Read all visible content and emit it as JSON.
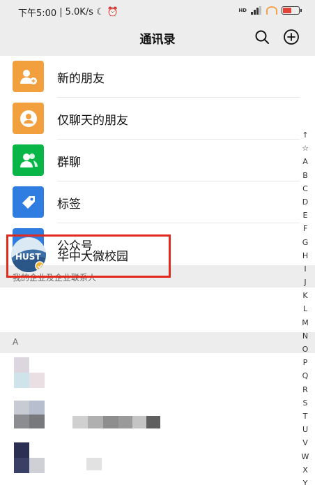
{
  "status_bar": {
    "time": "下午5:00",
    "speed": "5.0K/s",
    "hd": "HD"
  },
  "header": {
    "title": "通讯录",
    "search_icon": "search-icon",
    "add_icon": "add-circle-icon"
  },
  "functions": [
    {
      "label": "新的朋友",
      "icon": "add-friend-icon",
      "color": "#f29f3d"
    },
    {
      "label": "仅聊天的朋友",
      "icon": "chat-only-friend-icon",
      "color": "#f29f3d"
    },
    {
      "label": "群聊",
      "icon": "group-chat-icon",
      "color": "#08b648"
    },
    {
      "label": "标签",
      "icon": "tag-icon",
      "color": "#2f7de1"
    },
    {
      "label": "公众号",
      "icon": "official-account-icon",
      "color": "#2f7de1"
    }
  ],
  "enterprise_section": {
    "header": "我的企业及企业联系人",
    "item_label": "华中大微校园",
    "avatar_text": "HUST"
  },
  "letter_section": {
    "header": "A"
  },
  "index_letters": [
    "↑",
    "☆",
    "A",
    "B",
    "C",
    "D",
    "E",
    "F",
    "G",
    "H",
    "I",
    "J",
    "K",
    "L",
    "M",
    "N",
    "O",
    "P",
    "Q",
    "R",
    "S",
    "T",
    "U",
    "V",
    "W",
    "X",
    "Y"
  ]
}
